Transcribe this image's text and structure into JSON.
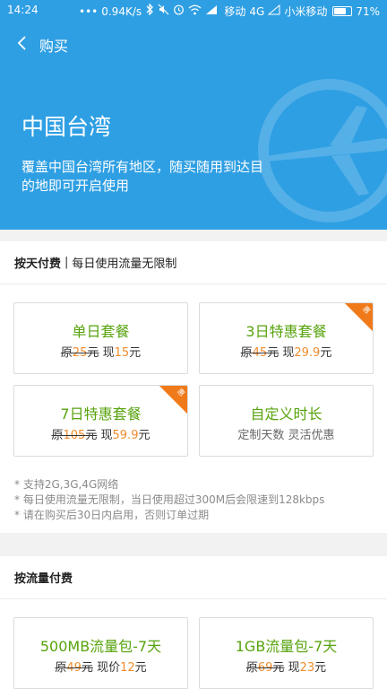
{
  "status_bar": {
    "time": "14:24",
    "dots": "•••",
    "speed": "0.94K/s",
    "carrier1": "移动",
    "network": "4G",
    "carrier2": "小米移动",
    "battery": "71%",
    "battery_level": 0.71
  },
  "app_bar": {
    "title": "购买"
  },
  "banner": {
    "title": "中国台湾",
    "description": "覆盖中国台湾所有地区，随买随用到达目的地即可开启使用"
  },
  "daily": {
    "header_bold": "按天付费",
    "header_sep": "|",
    "header_rest": "每日使用流量无限制",
    "plans": [
      {
        "name": "单日套餐",
        "orig_prefix": "原",
        "orig_num": "25",
        "orig_unit": "元",
        "now_prefix": "现",
        "now_num": "15",
        "now_unit": "元"
      },
      {
        "name": "3日特惠套餐",
        "orig_prefix": "原",
        "orig_num": "45",
        "orig_unit": "元",
        "now_prefix": "现",
        "now_num": "29.9",
        "now_unit": "元",
        "badge": "惠"
      },
      {
        "name": "7日特惠套餐",
        "orig_prefix": "原",
        "orig_num": "105",
        "orig_unit": "元",
        "now_prefix": "现",
        "now_num": "59.9",
        "now_unit": "元",
        "badge": "惠"
      },
      {
        "name": "自定义时长",
        "sub": "定制天数 灵活优惠"
      }
    ],
    "notes": [
      "* 支持2G,3G,4G网络",
      "* 每日使用流量无限制，当日使用超过300M后会限速到128kbps",
      "* 请在购买后30日内启用，否则订单过期"
    ]
  },
  "traffic": {
    "header": "按流量付费",
    "plans": [
      {
        "name": "500MB流量包-7天",
        "orig_prefix": "原",
        "orig_num": "49",
        "orig_unit": "元",
        "now_prefix": "现价",
        "now_num": "12",
        "now_unit": "元"
      },
      {
        "name": "1GB流量包-7天",
        "orig_prefix": "原",
        "orig_num": "69",
        "orig_unit": "元",
        "now_prefix": "现",
        "now_num": "23",
        "now_unit": "元"
      }
    ]
  },
  "colors": {
    "primary": "#2f9fe3",
    "plan_name": "#57a30d",
    "price": "#f08c2c",
    "badge": "#f07a1a"
  },
  "icons": {
    "back": "chevron-left-icon",
    "plane": "airplane-icon",
    "bluetooth": "bluetooth-icon",
    "mute": "mute-icon",
    "alarm": "alarm-icon",
    "wifi": "wifi-icon",
    "signal": "signal-icon"
  }
}
